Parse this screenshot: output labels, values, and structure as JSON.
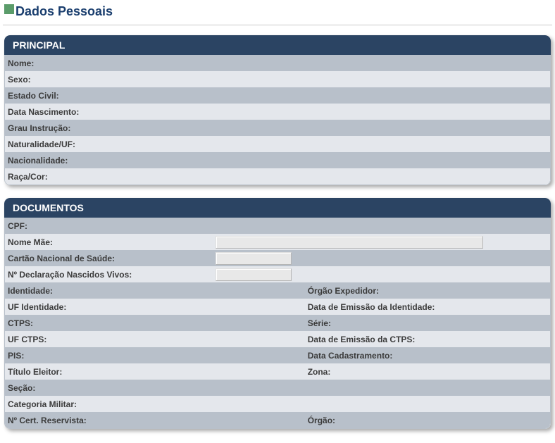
{
  "page": {
    "title": "Dados Pessoais"
  },
  "principal": {
    "header": "PRINCIPAL",
    "rows": [
      {
        "label": "Nome:",
        "value": ""
      },
      {
        "label": "Sexo:",
        "value": ""
      },
      {
        "label": "Estado Civil:",
        "value": ""
      },
      {
        "label": "Data Nascimento:",
        "value": ""
      },
      {
        "label": "Grau Instrução:",
        "value": ""
      },
      {
        "label": "Naturalidade/UF:",
        "value": ""
      },
      {
        "label": "Nacionalidade:",
        "value": ""
      },
      {
        "label": "Raça/Cor:",
        "value": ""
      }
    ]
  },
  "documentos": {
    "header": "DOCUMENTOS",
    "cpf_label": "CPF:",
    "cpf_value": "",
    "nome_mae_label": "Nome Mãe:",
    "nome_mae_value": "",
    "cns_label": "Cartão Nacional de Saúde:",
    "cns_value": "",
    "dnv_label": "Nº Declaração Nascidos Vivos:",
    "dnv_value": "",
    "pairs": [
      {
        "l1": "Identidade:",
        "v1": "",
        "l2": "Órgão Expedidor:",
        "v2": ""
      },
      {
        "l1": "UF Identidade:",
        "v1": "",
        "l2": "Data de Emissão da Identidade:",
        "v2": ""
      },
      {
        "l1": "CTPS:",
        "v1": "",
        "l2": "Série:",
        "v2": ""
      },
      {
        "l1": "UF CTPS:",
        "v1": "",
        "l2": "Data de Emissão da CTPS:",
        "v2": ""
      },
      {
        "l1": "PIS:",
        "v1": "",
        "l2": "Data Cadastramento:",
        "v2": ""
      },
      {
        "l1": "Título Eleitor:",
        "v1": "",
        "l2": "Zona:",
        "v2": ""
      }
    ],
    "secao_label": "Seção:",
    "secao_value": "",
    "cat_militar_label": "Categoria Militar:",
    "cat_militar_value": "",
    "reservista_label": "Nº Cert. Reservista:",
    "reservista_value": "",
    "orgao_label": "Órgão:",
    "orgao_value": ""
  }
}
